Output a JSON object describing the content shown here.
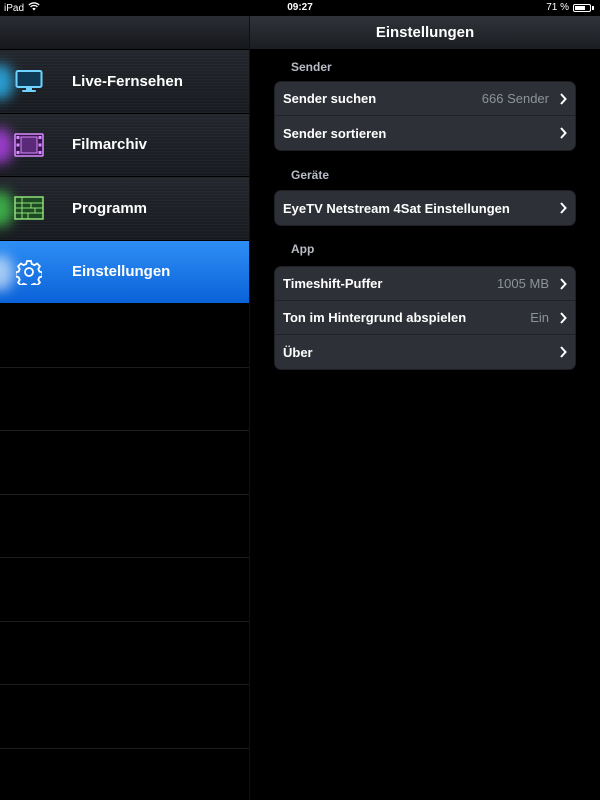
{
  "status_bar": {
    "device": "iPad",
    "time": "09:27",
    "battery_text": "71 %",
    "battery_level": 0.71
  },
  "sidebar": {
    "items": [
      {
        "label": "Live-Fernsehen",
        "icon": "tv-icon",
        "glow_color": "#2aa8e0",
        "active": false
      },
      {
        "label": "Filmarchiv",
        "icon": "film-icon",
        "glow_color": "#a43fd8",
        "active": false
      },
      {
        "label": "Programm",
        "icon": "program-guide-icon",
        "glow_color": "#3fb84a",
        "active": false
      },
      {
        "label": "Einstellungen",
        "icon": "gear-icon",
        "glow_color": "#ffffff",
        "active": true
      }
    ]
  },
  "main": {
    "title": "Einstellungen",
    "sections": [
      {
        "header": "Sender",
        "rows": [
          {
            "label": "Sender suchen",
            "value": "666 Sender"
          },
          {
            "label": "Sender sortieren",
            "value": ""
          }
        ]
      },
      {
        "header": "Geräte",
        "rows": [
          {
            "label": "EyeTV Netstream 4Sat Einstellungen",
            "value": ""
          }
        ]
      },
      {
        "header": "App",
        "rows": [
          {
            "label": "Timeshift-Puffer",
            "value": "1005 MB"
          },
          {
            "label": "Ton im Hintergrund abspielen",
            "value": "Ein"
          },
          {
            "label": "Über",
            "value": ""
          }
        ]
      }
    ]
  },
  "colors": {
    "accent": "#0a6ee0",
    "background": "#000000",
    "cell_background": "#2d3036"
  }
}
